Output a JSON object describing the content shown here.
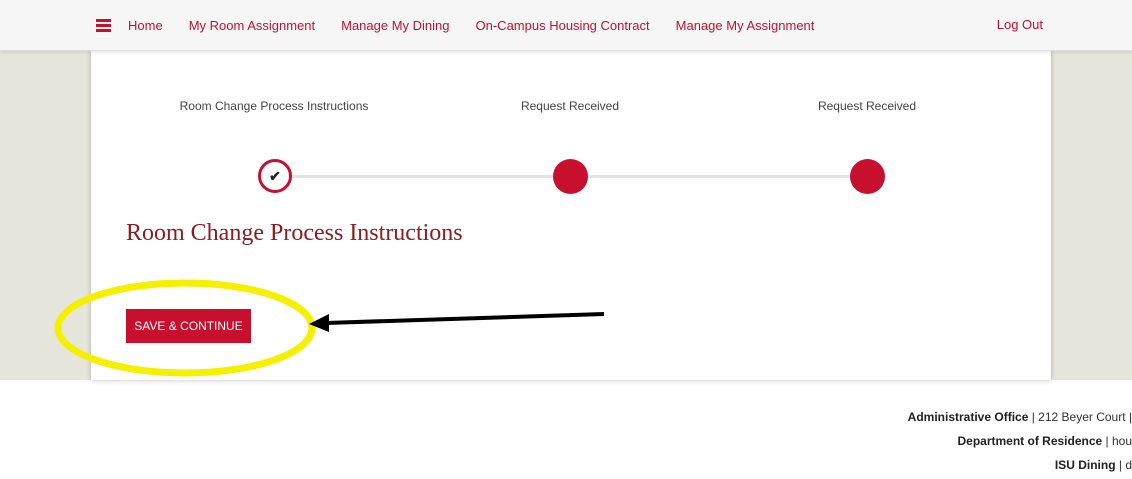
{
  "nav": {
    "items": [
      {
        "label": "Home"
      },
      {
        "label": "My Room Assignment"
      },
      {
        "label": "Manage My Dining"
      },
      {
        "label": "On-Campus Housing Contract"
      },
      {
        "label": "Manage My Assignment"
      }
    ],
    "logout_label": "Log Out",
    "menu_icon": "hamburger-menu-icon"
  },
  "steps": [
    {
      "label": "Room Change Process Instructions",
      "status": "completed",
      "icon": "checkmark-icon"
    },
    {
      "label": "Request Received",
      "status": "pending"
    },
    {
      "label": "Request Received",
      "status": "pending"
    }
  ],
  "main": {
    "title": "Room Change Process Instructions",
    "save_button_label": "SAVE & CONTINUE"
  },
  "footer": {
    "lines": [
      {
        "name": "Administrative Office",
        "detail": " | 212 Beyer Court |"
      },
      {
        "name": "Department of Residence",
        "detail": " | hou"
      },
      {
        "name": "ISU Dining",
        "detail": " | d"
      }
    ]
  },
  "colors": {
    "brand_red": "#c8102e",
    "title_red": "#8c1d22",
    "annotation_highlight": "#f5f000",
    "annotation_arrow": "#000000",
    "side_band": "#e7e6dd"
  }
}
